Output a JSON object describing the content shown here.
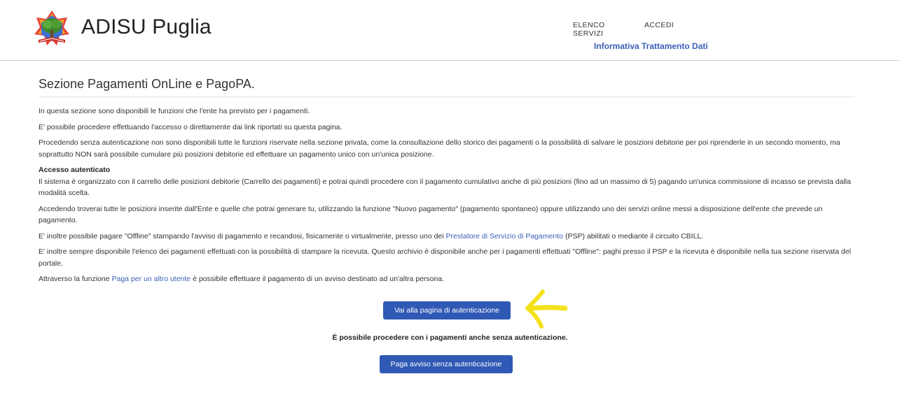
{
  "header": {
    "site_title": "ADISU Puglia",
    "nav": {
      "elenco_servizi": "ELENCO SERVIZI",
      "accedi": "ACCEDI",
      "informativa": "Informativa Trattamento Dati"
    },
    "logo_icon": "adisu-logo-tree-icon"
  },
  "main": {
    "title": "Sezione Pagamenti OnLine e PagoPA.",
    "paragraphs": {
      "p1": "In questa sezione sono disponibili le funzioni che l'ente ha previsto per i pagamenti.",
      "p2": "E' possibile procedere effettuando l'accesso o direttamente dai link riportati su questa pagina.",
      "p3": "Procedendo senza autenticazione non sono disponibili tutte le funzioni riservate nella sezione privata, come la consultazione dello storico dei pagamenti o la possibilità di salvare le posizioni debitorie per poi riprenderle in un secondo momento, ma soprattutto NON sarà possibile cumulare più posizioni debitorie ed effettuare un pagamento unico con un'unica posizione.",
      "p4_heading": "Accesso autenticato",
      "p4": "Il sistema è organizzato con il carrello delle posizioni debitorie (Carrello dei pagamenti) e potrai quindi procedere con il pagamento cumulativo anche di più posizioni (fino ad un massimo di 5) pagando un'unica commissione di incasso se prevista dalla modalità scelta.",
      "p5": "Accedendo troverai tutte le posizioni inserite dall'Ente e quelle che potrai generare tu, utilizzando la funzione \"Nuovo pagamento\" (pagamento spontaneo) oppure utilizzando uno dei servizi online messi a disposizione dell'ente che prevede un pagamento.",
      "p6_before": "E' inoltre possibile pagare \"Offline\" stampando l'avviso di pagamento e recandosi, fisicamente o virtualmente, presso uno dei ",
      "p6_link": "Prestatore di Servizio di Pagamento",
      "p6_after": " (PSP) abilitati o mediante il circuito CBILL.",
      "p7": "E' inoltre sempre disponibile l'elenco dei pagamenti effettuati con la possibilità di stampare la ricevuta. Questo archivio è disponibile anche per i pagamenti effettuati \"Offline\": paghi presso il PSP e la ricevuta è disponibile nella tua sezione riservata del portale.",
      "p8_before": "Attraverso la funzione ",
      "p8_link": "Paga per un altro utente",
      "p8_after": " è possibile effettuare il pagamento di un avviso destinato ad un'altra persona."
    },
    "auth_button": "Vai alla pagina di autenticazione",
    "no_auth_note": "È possibile procedere con i pagamenti anche senza autenticazione.",
    "guest_button": "Paga avviso senza autenticazione"
  },
  "colors": {
    "accent": "#2f59b5",
    "link": "#3a5fb8",
    "annotation": "#f5e11a"
  },
  "annotation": {
    "icon": "yellow-arrow-left-icon"
  }
}
